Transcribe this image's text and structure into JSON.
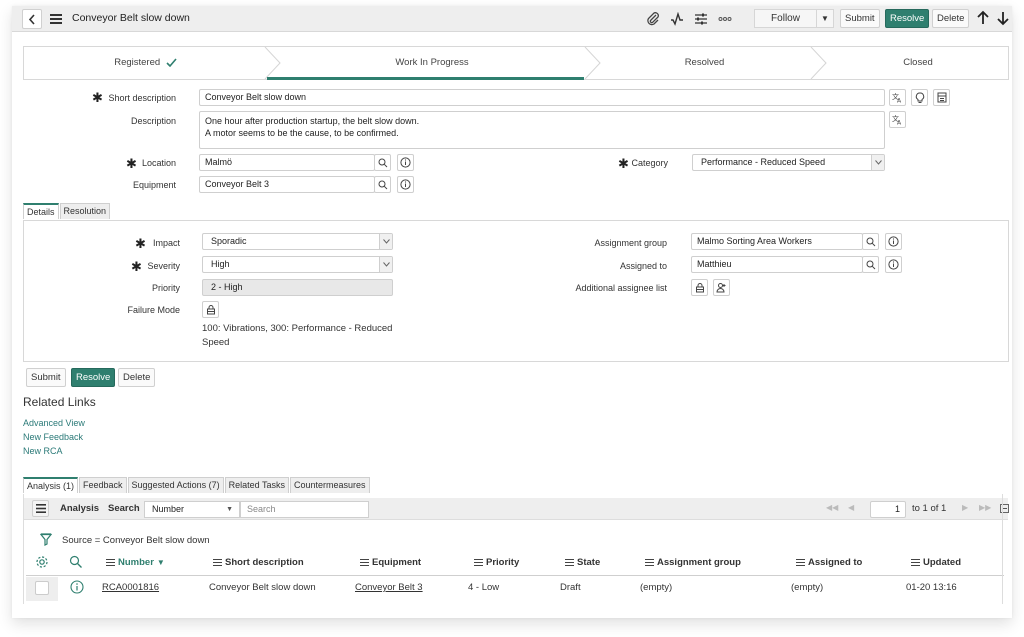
{
  "header": {
    "title": "Conveyor Belt slow down",
    "follow_label": "Follow",
    "submit_label": "Submit",
    "resolve_label": "Resolve",
    "delete_label": "Delete",
    "icons": [
      "back-icon",
      "menu-icon",
      "paperclip-icon",
      "activity-icon",
      "settings-sliders-icon",
      "more-icon",
      "arrow-up-icon",
      "arrow-down-icon"
    ]
  },
  "flow": {
    "stages": [
      {
        "label": "Registered",
        "done": true
      },
      {
        "label": "Work In Progress",
        "active": true
      },
      {
        "label": "Resolved"
      },
      {
        "label": "Closed"
      }
    ]
  },
  "form": {
    "short_description": {
      "label": "Short description",
      "value": "Conveyor Belt slow down",
      "required": true
    },
    "description": {
      "label": "Description",
      "lines": [
        "One hour after production startup, the belt slow down.",
        "A motor seems to be the cause, to be confirmed."
      ]
    },
    "location": {
      "label": "Location",
      "value": "Malmö",
      "required": true
    },
    "equipment": {
      "label": "Equipment",
      "value": "Conveyor Belt 3"
    },
    "category": {
      "label": "Category",
      "value": "Performance - Reduced Speed",
      "required": true
    }
  },
  "section_tabs": [
    "Details",
    "Resolution"
  ],
  "details": {
    "impact": {
      "label": "Impact",
      "value": "Sporadic",
      "required": true
    },
    "severity": {
      "label": "Severity",
      "value": "High",
      "required": true
    },
    "priority": {
      "label": "Priority",
      "value": "2 - High"
    },
    "failure_mode": {
      "label": "Failure Mode",
      "value_line1": "100: Vibrations, 300: Performance - Reduced",
      "value_line2": "Speed"
    },
    "assignment_group": {
      "label": "Assignment group",
      "value": "Malmo Sorting Area Workers"
    },
    "assigned_to": {
      "label": "Assigned to",
      "value": "Matthieu"
    },
    "additional_assignee": {
      "label": "Additional assignee list"
    }
  },
  "footer_buttons": {
    "submit": "Submit",
    "resolve": "Resolve",
    "delete": "Delete"
  },
  "related_links": {
    "title": "Related Links",
    "items": [
      "Advanced View",
      "New Feedback",
      "New RCA"
    ]
  },
  "related_tabs": [
    "Analysis (1)",
    "Feedback",
    "Suggested Actions (7)",
    "Related Tasks",
    "Countermeasures"
  ],
  "list": {
    "title": "Analysis",
    "search_label": "Search",
    "search_field": "Number",
    "search_placeholder": "Search",
    "page_value": "1",
    "page_info": "to 1 of 1",
    "filter_text": "Source = Conveyor Belt slow down",
    "columns": [
      "Number",
      "Short description",
      "Equipment",
      "Priority",
      "State",
      "Assignment group",
      "Assigned to",
      "Updated"
    ],
    "rows": [
      {
        "number": "RCA0001816",
        "short_description": "Conveyor Belt slow down",
        "equipment": "Conveyor Belt 3",
        "priority": "4 - Low",
        "state": "Draft",
        "assignment_group": "(empty)",
        "assigned_to": "(empty)",
        "updated": "01-20 13:16"
      }
    ]
  },
  "colors": {
    "accent": "#2f7f6f",
    "link": "#2b7a78",
    "header_bg": "#eeeeee"
  }
}
